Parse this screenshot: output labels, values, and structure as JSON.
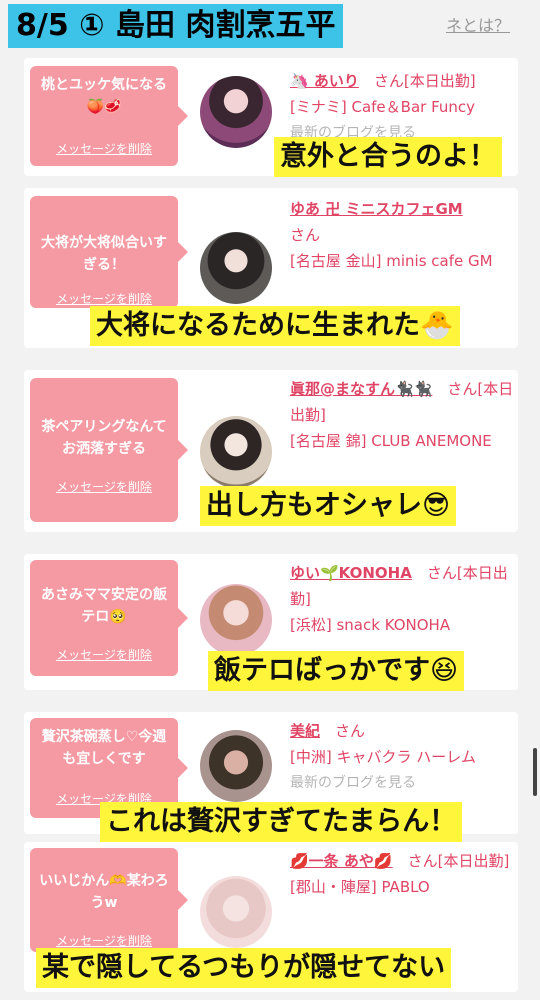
{
  "header": {
    "title": "8/5 ① 島田 肉割烹五平",
    "link": "ネとは？"
  },
  "delete_label": "メッセージを削除",
  "blog_label": "最新のブログを見る",
  "cards": [
    {
      "message": "桃とユッケ気になる🍑🥩",
      "name": "🦄 あいり",
      "san": "さん[本日出勤]",
      "shop": "[ミナミ] Cafe＆Bar Funcy",
      "caption": "意外と合うのよ！"
    },
    {
      "message": "大将が大将似合いすぎる！",
      "name": "ゆあ 卍 ミニスカフェGM",
      "san": "さん",
      "shop": "[名古屋 金山] minis cafe GM",
      "caption": "大将になるために生まれた🐣"
    },
    {
      "message": "茶ペアリングなんてお洒落すぎる",
      "name": "眞那@まなすん🐈‍⬛🐈‍⬛",
      "san": "さん[本日出勤]",
      "shop": "[名古屋 錦] CLUB ANEMONE",
      "caption": "出し方もオシャレ😎"
    },
    {
      "message": "あさみママ安定の飯テロ🥺",
      "name": "ゆい🌱KONOHA",
      "san": "さん[本日出勤]",
      "shop": "[浜松] snack KONOHA",
      "caption": "飯テロばっかです😆"
    },
    {
      "message": "贅沢茶碗蒸し♡今週も宜しくです",
      "name": "美紀",
      "san": "さん",
      "shop": "[中洲] キャバクラ ハーレム",
      "caption": "これは贅沢すぎてたまらん！"
    },
    {
      "message": "いいじかん🫶某わろうw",
      "name": "💋一条 あや💋",
      "san": "さん[本日出勤]",
      "shop": "[郡山・陣屋] PABLO",
      "caption": "某で隠してるつもりが隠せてない"
    }
  ],
  "colors": {
    "header_bg": "#3cc3e7",
    "bubble": "#f59aa3",
    "accent": "#e04565",
    "caption_bg": "#fff53a"
  }
}
